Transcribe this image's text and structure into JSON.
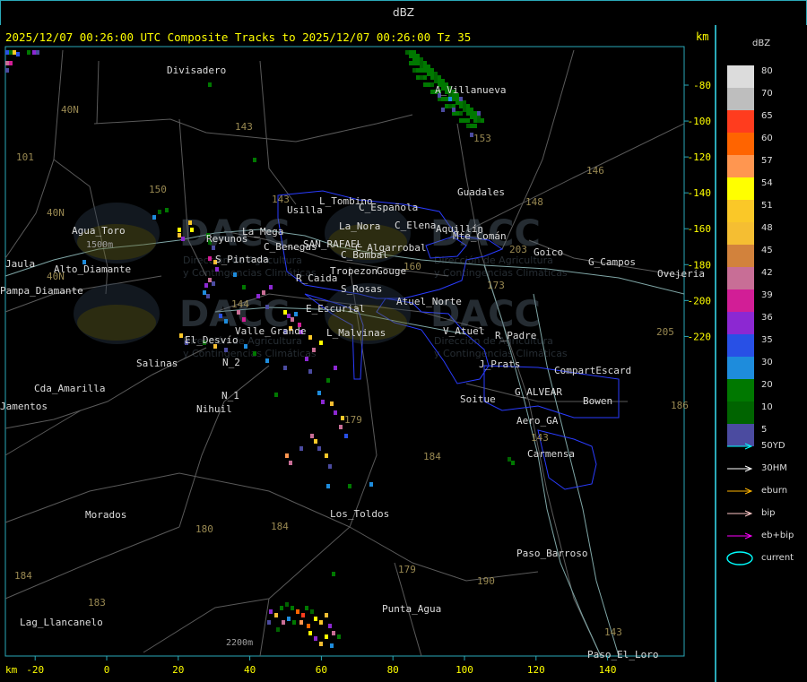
{
  "window": {
    "title": "dBZ"
  },
  "header": {
    "text": "2025/12/07 00:26:00 UTC Composite Tracks to 2025/12/07 00:26:00 Tz 35",
    "km_label": "km"
  },
  "legend": {
    "title": "dBZ",
    "levels": [
      {
        "label": "80",
        "color": "#dcdcdc"
      },
      {
        "label": "70",
        "color": "#bebebe"
      },
      {
        "label": "65",
        "color": "#ff3c1e"
      },
      {
        "label": "60",
        "color": "#ff6400"
      },
      {
        "label": "57",
        "color": "#ff9650"
      },
      {
        "label": "54",
        "color": "#ffff00"
      },
      {
        "label": "51",
        "color": "#fac828"
      },
      {
        "label": "48",
        "color": "#f5be32"
      },
      {
        "label": "45",
        "color": "#d2823c"
      },
      {
        "label": "42",
        "color": "#c86e96"
      },
      {
        "label": "39",
        "color": "#d21e96"
      },
      {
        "label": "36",
        "color": "#8c28d2"
      },
      {
        "label": "35",
        "color": "#2850e6"
      },
      {
        "label": "30",
        "color": "#1e8cdc"
      },
      {
        "label": "20",
        "color": "#007800"
      },
      {
        "label": "10",
        "color": "#006400"
      },
      {
        "label": "5",
        "color": "#4b4ba0"
      }
    ],
    "tracks": [
      {
        "label": "50YD",
        "color": "#00ffff"
      },
      {
        "label": "30HM",
        "color": "#ffffff"
      },
      {
        "label": "eburn",
        "color": "#ffb400"
      },
      {
        "label": "bip",
        "color": "#ffc8c8"
      },
      {
        "label": "eb+bip",
        "color": "#ff00ff"
      },
      {
        "label": "current",
        "color": "#00ffff"
      }
    ]
  },
  "axes": {
    "x_label": "km",
    "x_ticks": [
      "-20",
      "0",
      "20",
      "40",
      "60",
      "80",
      "100",
      "120",
      "140"
    ],
    "y_ticks": [
      "-80",
      "-100",
      "-120",
      "-140",
      "-160",
      "-180",
      "-200",
      "-220"
    ]
  },
  "places": [
    {
      "name": "Divisadero"
    },
    {
      "name": "A_Villanueva"
    },
    {
      "name": "Guadales"
    },
    {
      "name": "Usilla"
    },
    {
      "name": "L_Tombino"
    },
    {
      "name": "C_Española"
    },
    {
      "name": "La_Nora"
    },
    {
      "name": "C_Elena"
    },
    {
      "name": "Aquillín"
    },
    {
      "name": "Mte_Comán"
    },
    {
      "name": "Goico"
    },
    {
      "name": "G_Campos"
    },
    {
      "name": "Ovejeria"
    },
    {
      "name": "Agua_Toro"
    },
    {
      "name": "Reyunos"
    },
    {
      "name": "La_Mega"
    },
    {
      "name": "C_Benegas"
    },
    {
      "name": "SAN_RAFAEL"
    },
    {
      "name": "C_Algarrobal"
    },
    {
      "name": "C_Bombal"
    },
    {
      "name": "S_Pintada"
    },
    {
      "name": "Jaula"
    },
    {
      "name": "Pampa_Diamante"
    },
    {
      "name": "Alto_Diamante"
    },
    {
      "name": "Tropezon"
    },
    {
      "name": "Gouge"
    },
    {
      "name": "R_Caida"
    },
    {
      "name": "S_Rosas"
    },
    {
      "name": "Atuel_Norte"
    },
    {
      "name": "E_Escurial"
    },
    {
      "name": "Valle_Grande"
    },
    {
      "name": "L_Malvinas"
    },
    {
      "name": "V_Atuel"
    },
    {
      "name": "R_Padre"
    },
    {
      "name": "El_Desvío"
    },
    {
      "name": "N_2"
    },
    {
      "name": "Salinas"
    },
    {
      "name": "J_Prats"
    },
    {
      "name": "CompartEscard"
    },
    {
      "name": "Cda_Amarilla"
    },
    {
      "name": "N_1"
    },
    {
      "name": "Nihuil"
    },
    {
      "name": "G_ALVEAR"
    },
    {
      "name": "Soitue"
    },
    {
      "name": "Bowen"
    },
    {
      "name": "Aero_GA"
    },
    {
      "name": "Carmensa"
    },
    {
      "name": "Morados"
    },
    {
      "name": "Los_Toldos"
    },
    {
      "name": "Paso_Barroso"
    },
    {
      "name": "Punta_Agua"
    },
    {
      "name": "Lag_Llancanelo"
    },
    {
      "name": "Paso_El_Loro"
    },
    {
      "name": "Jamentos"
    }
  ],
  "routes": [
    {
      "name": "40N"
    },
    {
      "name": "40N"
    },
    {
      "name": "101"
    },
    {
      "name": "143"
    },
    {
      "name": "153"
    },
    {
      "name": "150"
    },
    {
      "name": "143"
    },
    {
      "name": "146"
    },
    {
      "name": "148"
    },
    {
      "name": "203"
    },
    {
      "name": "173"
    },
    {
      "name": "144"
    },
    {
      "name": "160"
    },
    {
      "name": "205"
    },
    {
      "name": "179"
    },
    {
      "name": "184"
    },
    {
      "name": "143"
    },
    {
      "name": "180"
    },
    {
      "name": "184"
    },
    {
      "name": "179"
    },
    {
      "name": "190"
    },
    {
      "name": "184"
    },
    {
      "name": "183"
    },
    {
      "name": "186"
    },
    {
      "name": "143"
    },
    {
      "name": "40N"
    }
  ],
  "annotations": {
    "agua_toro_elev": "1500m",
    "llancanelo_elev": "2200m",
    "watermark": "DACC",
    "watermark_sub1": "Dirección de Agricultura",
    "watermark_sub2": "y Contingencias Climáticas"
  }
}
